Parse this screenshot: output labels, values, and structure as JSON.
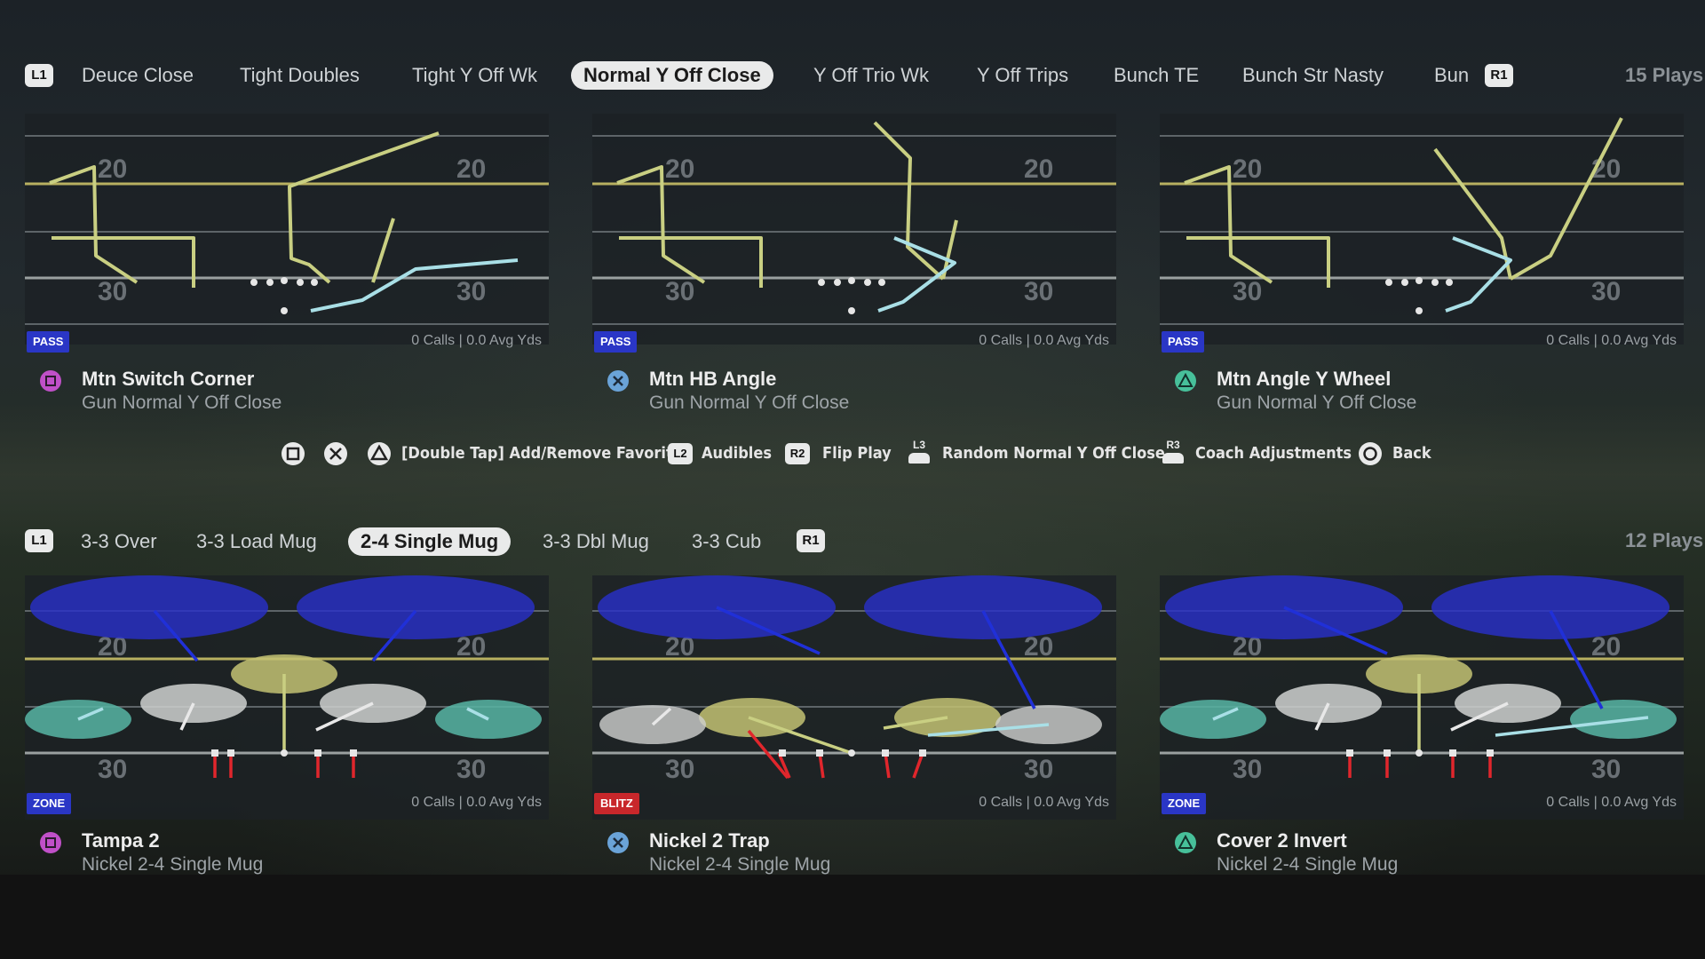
{
  "offense": {
    "left_bumper": "L1",
    "right_bumper": "R1",
    "tabs": [
      "Deuce Close",
      "Tight Doubles",
      "Tight Y Off Wk",
      "Normal Y Off Close",
      "Y Off Trio Wk",
      "Y Off Trips",
      "Bunch TE",
      "Bunch Str Nasty",
      "Bun"
    ],
    "active_tab_index": 3,
    "count_label": "15 Plays",
    "plays": [
      {
        "tag": "PASS",
        "stats": "0 Calls | 0.0 Avg Yds",
        "button": "square",
        "name": "Mtn Switch Corner",
        "formation": "Gun Normal Y Off Close"
      },
      {
        "tag": "PASS",
        "stats": "0 Calls | 0.0 Avg Yds",
        "button": "cross",
        "name": "Mtn HB Angle",
        "formation": "Gun Normal Y Off Close"
      },
      {
        "tag": "PASS",
        "stats": "0 Calls | 0.0 Avg Yds",
        "button": "triangle",
        "name": "Mtn Angle Y Wheel",
        "formation": "Gun Normal Y Off Close"
      }
    ]
  },
  "defense": {
    "left_bumper": "L1",
    "right_bumper": "R1",
    "tabs": [
      "3-3 Over",
      "3-3 Load Mug",
      "2-4 Single Mug",
      "3-3 Dbl Mug",
      "3-3 Cub"
    ],
    "active_tab_index": 2,
    "count_label": "12 Plays",
    "plays": [
      {
        "tag": "ZONE",
        "stats": "0 Calls | 0.0 Avg Yds",
        "button": "square",
        "name": "Tampa 2",
        "formation": "Nickel 2-4 Single Mug"
      },
      {
        "tag": "BLITZ",
        "stats": "0 Calls | 0.0 Avg Yds",
        "button": "cross",
        "name": "Nickel 2 Trap",
        "formation": "Nickel 2-4 Single Mug"
      },
      {
        "tag": "ZONE",
        "stats": "0 Calls | 0.0 Avg Yds",
        "button": "triangle",
        "name": "Cover 2 Invert",
        "formation": "Nickel 2-4 Single Mug"
      }
    ]
  },
  "legend": {
    "favorite": "[Double Tap] Add/Remove Favorite",
    "l2_badge": "L2",
    "audibles": "Audibles",
    "r2_badge": "R2",
    "flip_play": "Flip Play",
    "l3_badge": "L3",
    "random": "Random Normal Y Off Close",
    "r3_badge": "R3",
    "coach": "Coach Adjustments",
    "back": "Back"
  },
  "field_numbers": [
    "20",
    "30"
  ],
  "colors": {
    "route_yellow": "#c9cf82",
    "route_teal": "#a9dfe6",
    "zone_blue": "#2830c8",
    "zone_gray": "#cfd1d0",
    "zone_yellow": "#c3c273",
    "zone_teal": "#57b5a5",
    "blitz_red": "#e0262c",
    "pass_tag": "#2a36c6",
    "blitz_tag": "#c8272b",
    "square_button": "#c050c8",
    "cross_button": "#6aa3d8",
    "triangle_button": "#47c09a"
  }
}
